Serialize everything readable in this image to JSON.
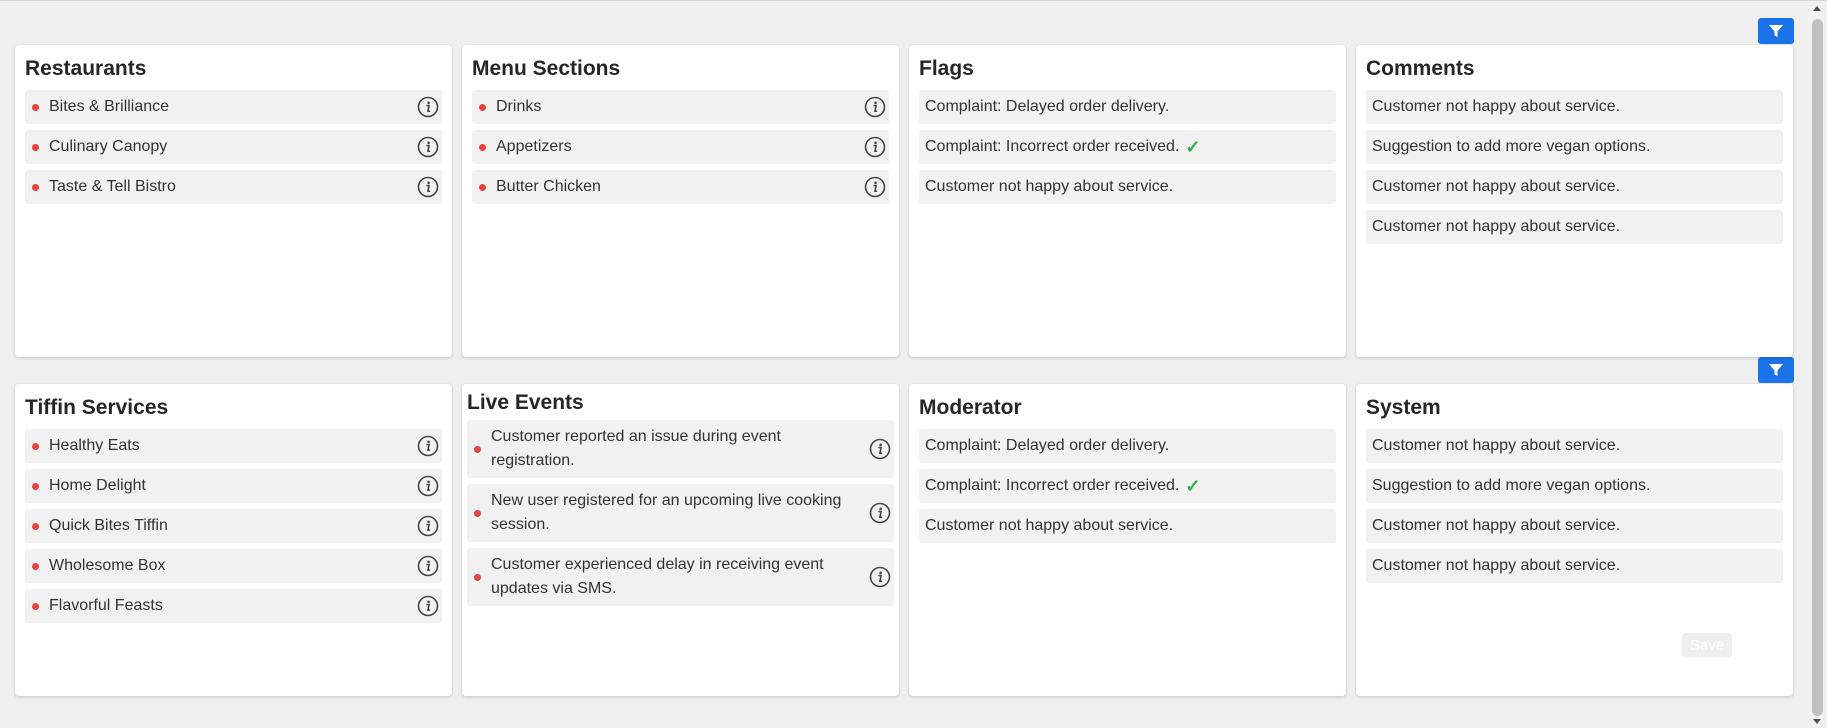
{
  "restaurants": {
    "title": "Restaurants",
    "items": [
      "Bites & Brilliance",
      "Culinary Canopy",
      "Taste & Tell Bistro"
    ]
  },
  "menu_sections": {
    "title": "Menu Sections",
    "items": [
      "Drinks",
      "Appetizers",
      "Butter Chicken"
    ]
  },
  "flags": {
    "title": "Flags",
    "items": [
      "Complaint: Delayed order delivery.",
      "Complaint: Incorrect order received.",
      "Customer not happy about service."
    ],
    "check": "✓"
  },
  "comments": {
    "title": "Comments",
    "items": [
      "Customer not happy about service.",
      "Suggestion to add more vegan options.",
      "Customer not happy about service.",
      "Customer not happy about service."
    ]
  },
  "tiffin_services": {
    "title": "Tiffin Services",
    "items": [
      "Healthy Eats",
      "Home Delight",
      "Quick Bites Tiffin",
      "Wholesome Box",
      "Flavorful Feasts"
    ]
  },
  "live_events": {
    "title": "Live Events",
    "items": [
      "Customer reported an issue during event registration.",
      "New user registered for an upcoming live cooking session.",
      "Customer experienced delay in receiving event updates via SMS."
    ]
  },
  "moderator": {
    "title": "Moderator",
    "items": [
      "Complaint: Delayed order delivery.",
      "Complaint: Incorrect order received.",
      "Customer not happy about service."
    ],
    "check": "✓"
  },
  "system": {
    "title": "System",
    "items": [
      "Customer not happy about service.",
      "Suggestion to add more vegan options.",
      "Customer not happy about service.",
      "Customer not happy about service."
    ],
    "save_label": "Save"
  },
  "icons": {
    "info": "info-icon",
    "filter": "filter-icon",
    "check": "checkmark-icon"
  },
  "colors": {
    "accent": "#1a73e8",
    "bullet": "#e8423f",
    "check": "#2bb04a",
    "row_bg": "#f1f1f2"
  }
}
